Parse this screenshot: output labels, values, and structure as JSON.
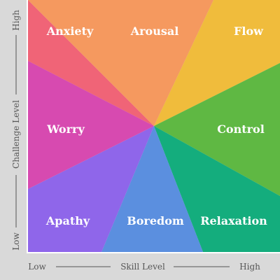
{
  "x_axis": {
    "title": "Skill Level",
    "low": "Low",
    "high": "High"
  },
  "y_axis": {
    "title": "Challenge Level",
    "low": "Low",
    "high": "High"
  },
  "states": [
    {
      "key": "anxiety",
      "label": "Anxiety",
      "color": "#f06477"
    },
    {
      "key": "arousal",
      "label": "Arousal",
      "color": "#f5995f"
    },
    {
      "key": "flow",
      "label": "Flow",
      "color": "#f0bc3c"
    },
    {
      "key": "control",
      "label": "Control",
      "color": "#5fb843"
    },
    {
      "key": "relaxation",
      "label": "Relaxation",
      "color": "#14ad7d"
    },
    {
      "key": "boredom",
      "label": "Boredom",
      "color": "#5b8fdf"
    },
    {
      "key": "apathy",
      "label": "Apathy",
      "color": "#8f66ea"
    },
    {
      "key": "worry",
      "label": "Worry",
      "color": "#d74ab0"
    }
  ],
  "colors": {
    "background": "#d9d9d9",
    "axis_line": "#ffffff",
    "axis_text": "#555555",
    "label_text": "#ffffff"
  }
}
